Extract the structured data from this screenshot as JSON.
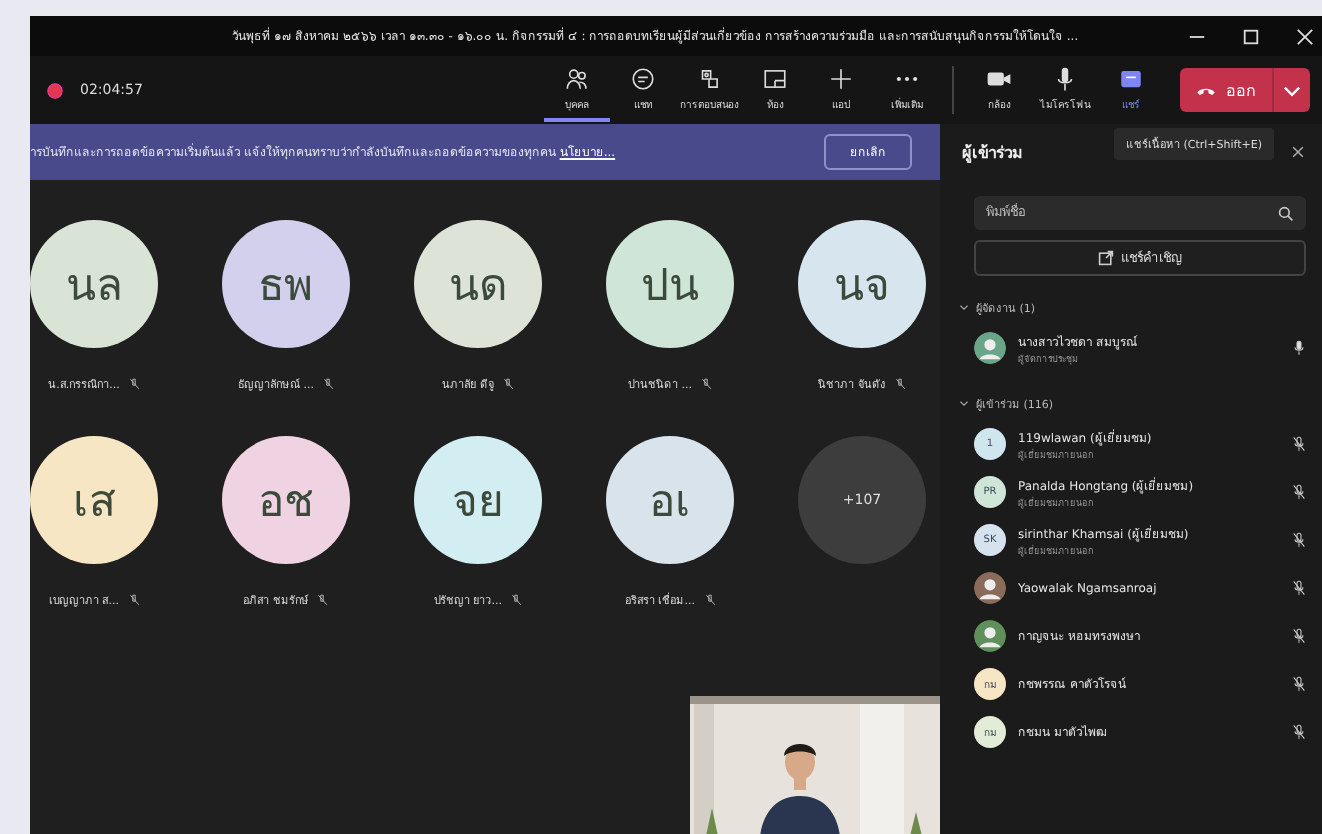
{
  "window": {
    "title": "วันพุธที่ ๑๗ สิงหาคม ๒๕๖๖ เวลา ๑๓.๓๐ - ๑๖.๐๐ น. กิจกรรมที่ ๔ : การถอดบทเรียนผู้มีส่วนเกี่ยวข้อง การสร้างความร่วมมือ และการสนับสนุนกิจกรรมให้โดนใจ ..."
  },
  "meeting": {
    "timer": "02:04:57",
    "recording": true
  },
  "toolbar": [
    {
      "kind": "people",
      "label": "บุคคล",
      "selected": true
    },
    {
      "kind": "chat",
      "label": "แชท",
      "selected": false
    },
    {
      "kind": "react",
      "label": "การตอบสนอง",
      "selected": false
    },
    {
      "kind": "rooms",
      "label": "ห้อง",
      "selected": false
    },
    {
      "kind": "apps",
      "label": "แอป",
      "selected": false
    },
    {
      "kind": "more",
      "label": "เพิ่มเติม",
      "selected": false
    },
    {
      "kind": "camera",
      "label": "กล้อง",
      "selected": false
    },
    {
      "kind": "mic",
      "label": "ไมโครโฟน",
      "selected": false
    },
    {
      "kind": "share",
      "label": "แชร์",
      "selected": true
    }
  ],
  "leave_button": {
    "label": "ออก"
  },
  "banner": {
    "message": "ารบันทึกและการถอดข้อความเริ่มต้นแล้ว  แจ้งให้ทุกคนทราบว่ากำลังบันทึกและถอดข้อความของทุกคน",
    "link": "นโยบาย...",
    "button": "ยกเลิก"
  },
  "tiles": [
    {
      "initials": "นล",
      "name": "น.ส.กรรณิกา...",
      "color": "#d9e3d6",
      "muted": true
    },
    {
      "initials": "ธพ",
      "name": "ธัญญาลักษณ์ ...",
      "color": "#d3d0ee",
      "muted": true
    },
    {
      "initials": "นด",
      "name": "นภาลัย ดีจู",
      "color": "#dde3d6",
      "muted": true
    },
    {
      "initials": "ปน",
      "name": "ปานชนิดา ...",
      "color": "#cfe5d7",
      "muted": true
    },
    {
      "initials": "นจ",
      "name": "นิชาภา จันดัง",
      "color": "#d6e5ee",
      "muted": true
    },
    {
      "initials": "เส",
      "name": "เบญญาภา ส...",
      "color": "#f6e6c3",
      "muted": true
    },
    {
      "initials": "อช",
      "name": "อภิสา ชมรักษ์",
      "color": "#f0d3e2",
      "muted": true
    },
    {
      "initials": "จย",
      "name": "ปรัชญา ยาว...",
      "color": "#d2eef2",
      "muted": true
    },
    {
      "initials": "อเ",
      "name": "อริสรา เชื่อม...",
      "color": "#d8e3ec",
      "muted": true
    }
  ],
  "overflow_tile": {
    "label": "+107"
  },
  "tooltip": {
    "text": "แชร์เนื้อหา (Ctrl+Shift+E)"
  },
  "panel": {
    "title": "ผู้เข้าร่วม",
    "search": {
      "placeholder": "พิมพ์ชื่อ"
    },
    "invite_button": "แชร์คำเชิญ",
    "sections": [
      {
        "title": "ผู้จัดงาน (1)",
        "expanded": true,
        "people": [
          {
            "name": "นางสาวไวชดา สมบูรณ์",
            "role": "ผู้จัดการประชุม",
            "muted": false,
            "color": "#6aa58a"
          }
        ]
      },
      {
        "title": "ผู้เข้าร่วม (116)",
        "expanded": true,
        "people": [
          {
            "kind": "initials",
            "initials": "1",
            "name": "119wlawan (ผู้เยี่ยมชม)",
            "role": "ผู้เยี่ยมชมภายนอก",
            "muted": true,
            "color": "#cfe6ee"
          },
          {
            "kind": "initials",
            "initials": "PR",
            "name": "Panalda Hongtang (ผู้เยี่ยมชม)",
            "role": "ผู้เยี่ยมชมภายนอก",
            "muted": true,
            "color": "#cfe5d7"
          },
          {
            "kind": "initials",
            "initials": "SK",
            "name": "sirinthar Khamsai (ผู้เยี่ยมชม)",
            "role": "ผู้เยี่ยมชมภายนอก",
            "muted": true,
            "color": "#d6e3ee"
          },
          {
            "name": "Yaowalak Ngamsanroaj",
            "muted": true,
            "color": "#8a6b5a"
          },
          {
            "name": "กาญจนะ หอมทรงพงษา",
            "muted": true,
            "color": "#5f8f5a"
          },
          {
            "kind": "initials",
            "initials": "กม",
            "name": "กชพรรณ คาตัวโรจน์",
            "muted": true,
            "color": "#f6e6c3"
          },
          {
            "kind": "initials",
            "initials": "กม",
            "name": "กชมน มาตัวไพฒ",
            "muted": true,
            "color": "#e3ecd6"
          }
        ]
      }
    ]
  }
}
